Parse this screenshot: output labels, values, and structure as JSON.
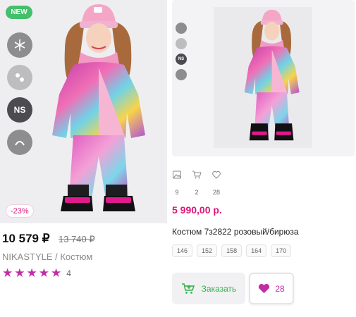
{
  "left_card": {
    "badge_new": "NEW",
    "discount": "-23%",
    "price": "10 579 ₽",
    "old_price": "13 740 ₽",
    "brand_line": "NIKASTYLE / Костюм",
    "rating_stars": 5,
    "rating_count": "4",
    "feature_icons": [
      "snowflake-icon",
      "pattern-icon",
      "ns-icon",
      "fabric-icon"
    ],
    "feature_ns_label": "NS"
  },
  "right_card": {
    "feature_icons": [
      "snowflake-icon",
      "pattern-icon",
      "ns-icon",
      "fabric-icon"
    ],
    "feature_ns_label": "NS",
    "stats": [
      {
        "icon": "image-icon",
        "value": "9"
      },
      {
        "icon": "cart-icon",
        "value": "2"
      },
      {
        "icon": "heart-icon",
        "value": "28"
      }
    ],
    "price": "5 990,00 р.",
    "title": "Костюм 7з2822 розовый/бирюза",
    "sizes": [
      "146",
      "152",
      "158",
      "164",
      "170"
    ],
    "order_label": "Заказать",
    "fav_count": "28"
  },
  "colors": {
    "accent_pink": "#e0157a",
    "star_magenta": "#c22ca6",
    "green": "#34b04a",
    "badge_green": "#43c06a"
  }
}
